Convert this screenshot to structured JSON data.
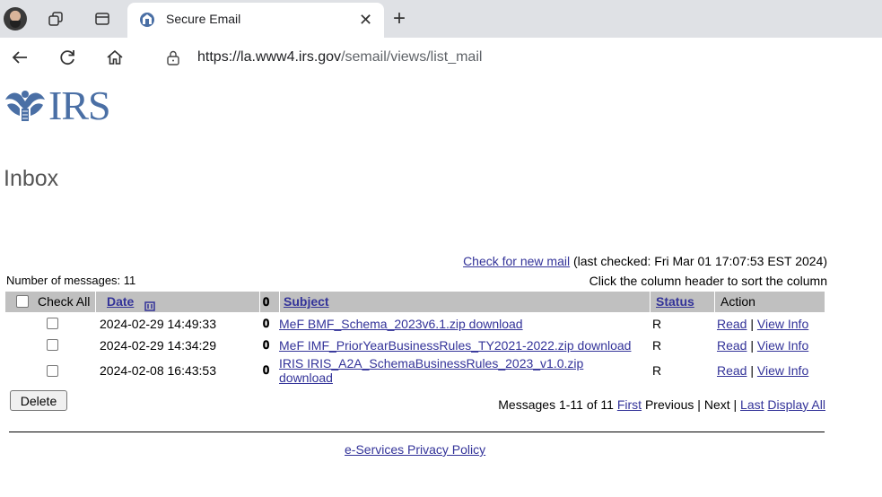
{
  "browser": {
    "tab_title": "Secure Email",
    "url_host": "https://la.www4.irs.gov",
    "url_path": "/semail/views/list_mail"
  },
  "page": {
    "logo_text": "IRS",
    "title": "Inbox",
    "check_new_mail_label": "Check for new mail",
    "last_checked": "(last checked: Fri Mar 01 17:07:53 EST 2024)",
    "number_of_messages": "Number of messages: 11",
    "sort_hint": "Click the column header to sort the column"
  },
  "table": {
    "headers": {
      "check_all": "Check All",
      "date": "Date",
      "subject": "Subject",
      "status": "Status",
      "action": "Action"
    },
    "rows": [
      {
        "date": "2024-02-29 14:49:33",
        "subject": "MeF BMF_Schema_2023v6.1.zip download",
        "subject2": "",
        "status": "R",
        "read": "Read",
        "sep": "|",
        "view": "View Info"
      },
      {
        "date": "2024-02-29 14:34:29",
        "subject": "MeF IMF_PriorYearBusinessRules_TY2021-2022.zip download",
        "subject2": "",
        "status": "R",
        "read": "Read",
        "sep": "|",
        "view": "View Info"
      },
      {
        "date": "2024-02-08 16:43:53",
        "subject": "IRIS IRIS_A2A_SchemaBusinessRules_2023_v1.0.zip",
        "subject2": "download",
        "status": "R",
        "read": "Read",
        "sep": "|",
        "view": "View Info"
      }
    ]
  },
  "actions": {
    "delete_label": "Delete"
  },
  "pager": {
    "summary": "Messages 1-11 of 11",
    "first": "First",
    "previous": "Previous",
    "sep": "|",
    "next": "Next",
    "last": "Last",
    "display_all": "Display All"
  },
  "footer": {
    "privacy": "e-Services Privacy Policy"
  },
  "colors": {
    "header_bg": "#c0c0c0",
    "link": "#333399",
    "irs_blue": "#4a6fa5"
  }
}
